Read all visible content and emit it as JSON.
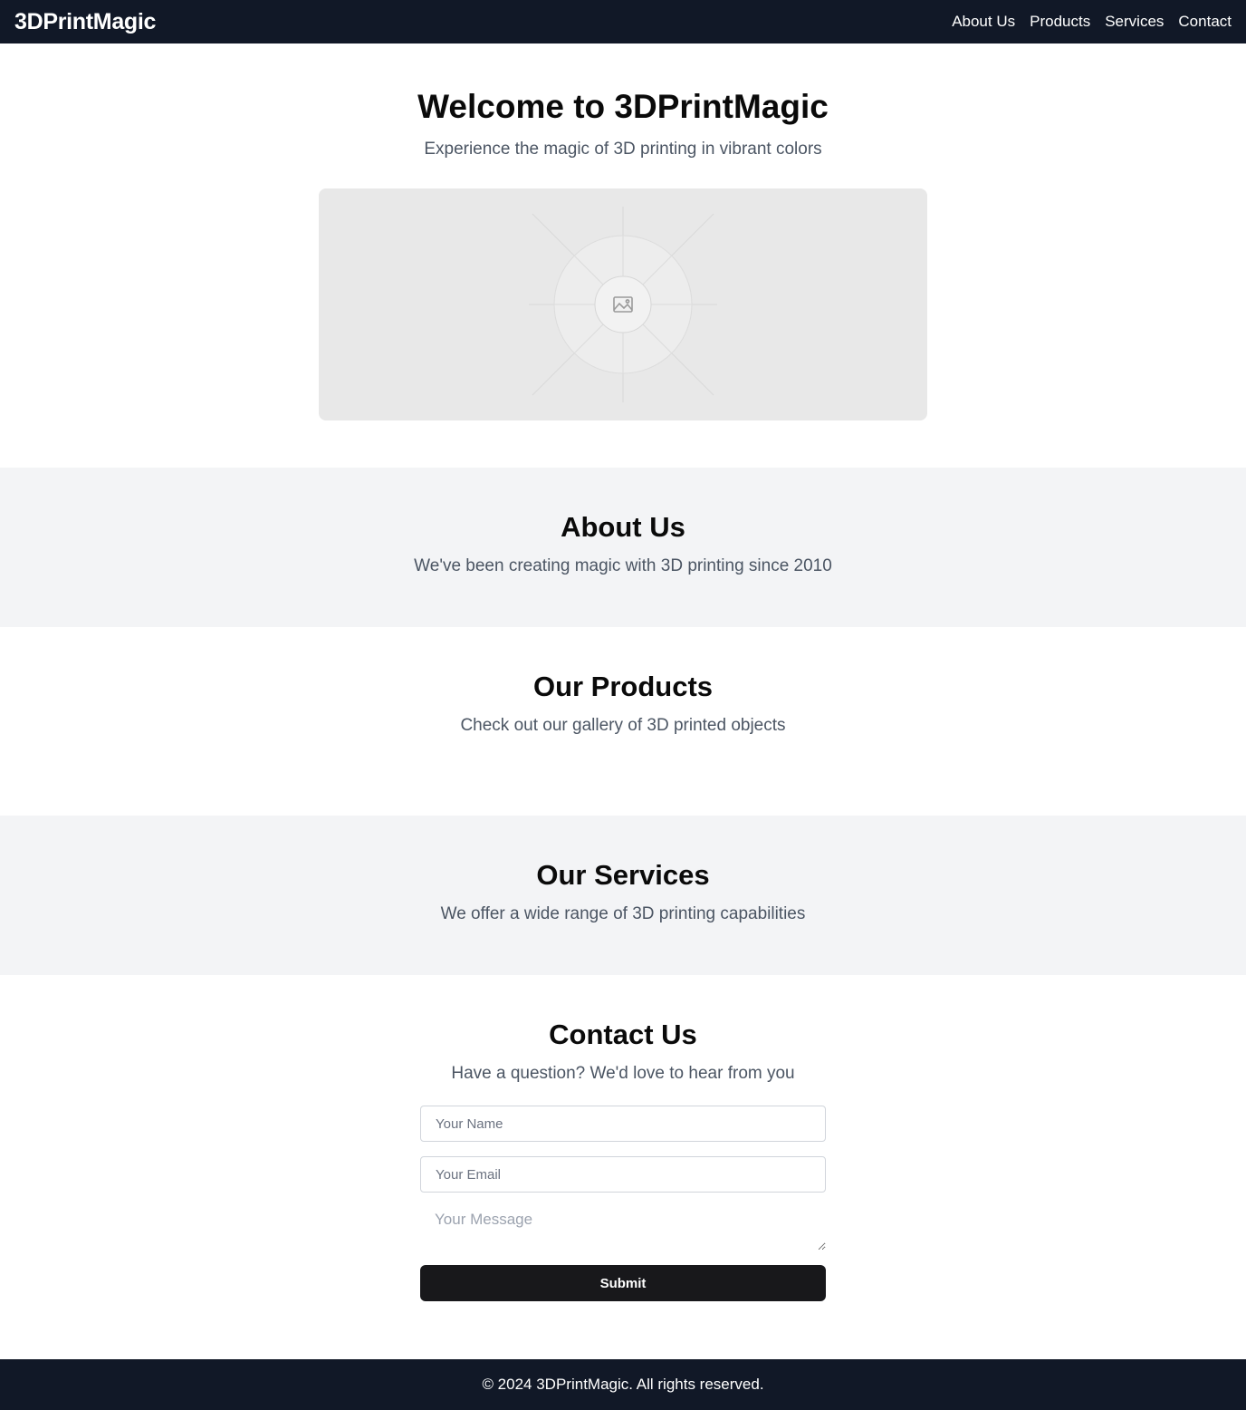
{
  "nav": {
    "brand": "3DPrintMagic",
    "links": [
      "About Us",
      "Products",
      "Services",
      "Contact"
    ]
  },
  "hero": {
    "title": "Welcome to 3DPrintMagic",
    "subtitle": "Experience the magic of 3D printing in vibrant colors",
    "image_icon": "image-icon"
  },
  "about": {
    "title": "About Us",
    "text": "We've been creating magic with 3D printing since 2010"
  },
  "products": {
    "title": "Our Products",
    "text": "Check out our gallery of 3D printed objects"
  },
  "services": {
    "title": "Our Services",
    "text": "We offer a wide range of 3D printing capabilities"
  },
  "contact": {
    "title": "Contact Us",
    "text": "Have a question? We'd love to hear from you",
    "name_placeholder": "Your Name",
    "email_placeholder": "Your Email",
    "message_placeholder": "Your Message",
    "submit_label": "Submit"
  },
  "footer": {
    "text": "© 2024 3DPrintMagic. All rights reserved."
  },
  "colors": {
    "navbar_bg": "#111827",
    "section_alt_bg": "#f3f4f6",
    "button_bg": "#18181b"
  }
}
